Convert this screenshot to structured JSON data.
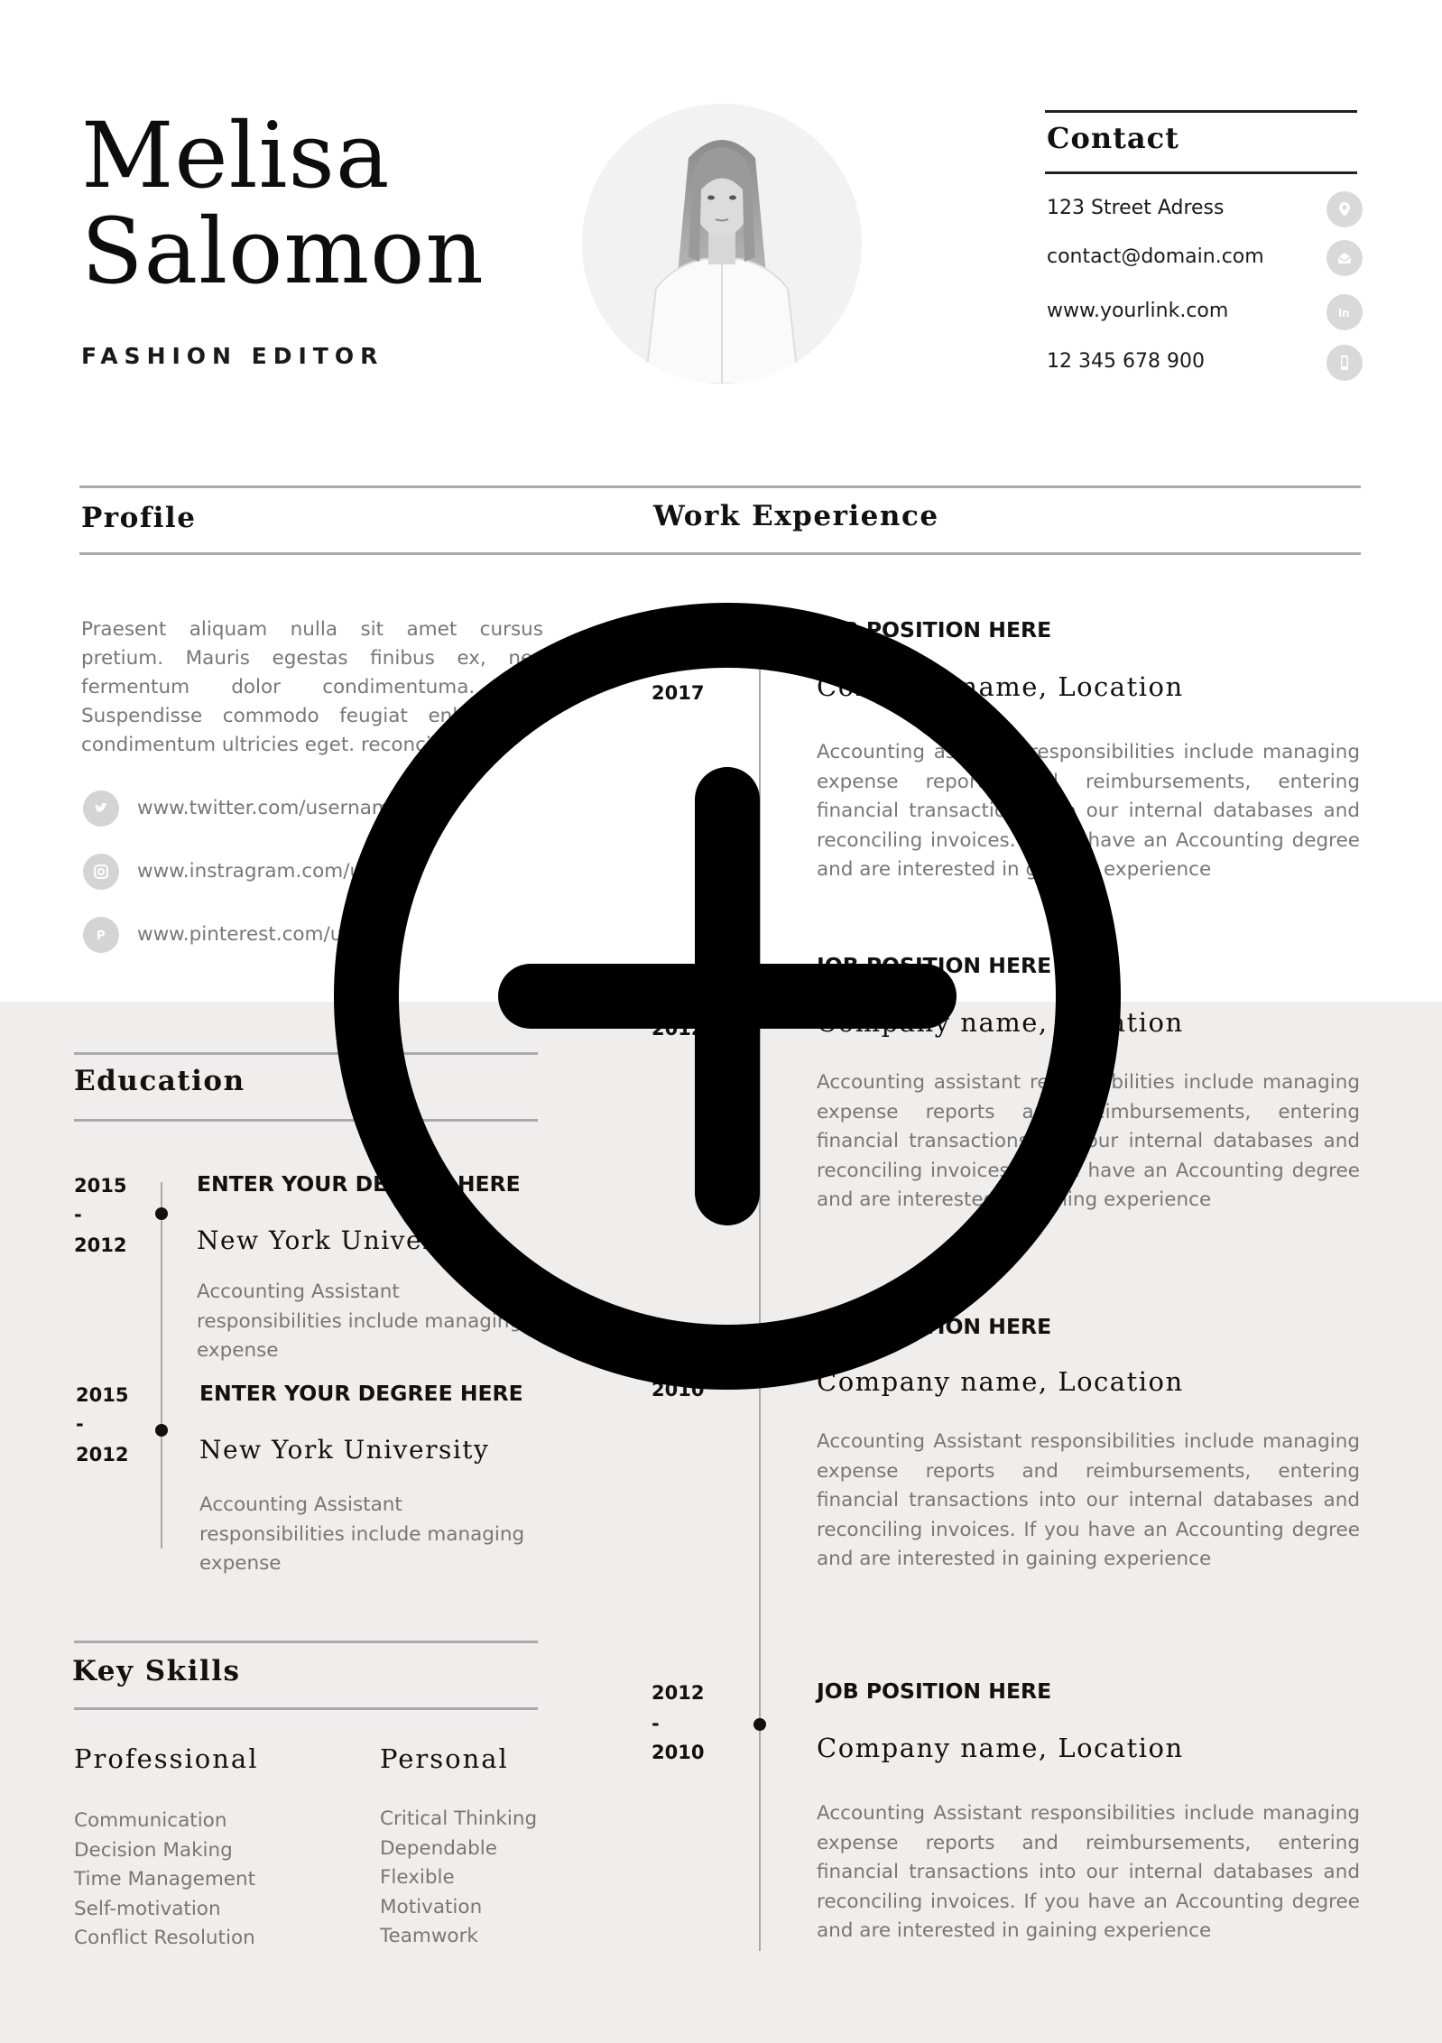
{
  "header": {
    "first_name": "Melisa",
    "last_name": "Salomon",
    "role": "FASHION EDITOR"
  },
  "contact": {
    "title": "Contact",
    "items": [
      {
        "text": "123 Street Adress",
        "icon": "location-pin-icon"
      },
      {
        "text": "contact@domain.com",
        "icon": "email-icon"
      },
      {
        "text": "www.yourlink.com",
        "icon": "linkedin-icon"
      },
      {
        "text": "12 345 678 900",
        "icon": "phone-icon"
      }
    ]
  },
  "profile": {
    "title": "Profile",
    "text": "Praesent aliquam nulla sit amet cursus pretium. Mauris egestas finibus ex, nec fermentum dolor condimentuma. At. Suspendisse commodo feugiat enla si le condimentum ultricies eget. reconcili the",
    "social": [
      {
        "text": "www.twitter.com/usernam",
        "icon": "twitter-icon"
      },
      {
        "text": "www.instragram.com/u",
        "icon": "instagram-icon"
      },
      {
        "text": "www.pinterest.com/us",
        "icon": "pinterest-icon"
      }
    ]
  },
  "work": {
    "title": "Work Experience",
    "jobs": [
      {
        "years": [
          "2017"
        ],
        "position": "JOB POSITION HERE",
        "company": "Company name, Location",
        "description": "Accounting assistant responsibilities include managing expense reports and reimbursements, entering financial transactions into our internal databases and reconciling invoices. If you have an Accounting degree and are interested in gaining experience"
      },
      {
        "years": [
          "2012"
        ],
        "position": "JOB POSITION HERE",
        "company": "Company name, Location",
        "description": "Accounting assistant responsibilities include managing expense reports and reimbursements, entering financial transactions into our internal databases and reconciling invoices. If you have an Accounting degree and are interested in gaining experience"
      },
      {
        "years": [
          "2010"
        ],
        "position": "JOB POSITION HERE",
        "company": "Company name, Location",
        "description": "Accounting Assistant responsibilities include managing expense reports and reimbursements, entering financial transactions into our internal databases and reconciling invoices. If you have an Accounting degree and are interested in gaining experience"
      },
      {
        "years": [
          "2012",
          "-",
          "2010"
        ],
        "position": "JOB POSITION HERE",
        "company": "Company name, Location",
        "description": "Accounting Assistant responsibilities include managing expense reports and reimbursements, entering financial transactions into our internal databases and reconciling invoices. If you have an Accounting degree and are interested in gaining experience"
      }
    ]
  },
  "education": {
    "title": "Education",
    "items": [
      {
        "start": "2015",
        "dash": "-",
        "end": "2012",
        "degree": "ENTER YOUR DEGREE HERE",
        "school": "New York University",
        "description": "Accounting Assistant responsibilities include managing expense"
      },
      {
        "start": "2015",
        "dash": "-",
        "end": "2012",
        "degree": "ENTER YOUR DEGREE HERE",
        "school": "New York University",
        "description": "Accounting Assistant responsibilities include managing expense"
      }
    ]
  },
  "skills": {
    "title": "Key Skills",
    "professional": {
      "title": "Professional",
      "items": [
        "Communication",
        "Decision Making",
        "Time Management",
        "Self-motivation",
        "Conflict Resolution"
      ]
    },
    "personal": {
      "title": "Personal",
      "items": [
        "Critical Thinking",
        "Dependable",
        "Flexible",
        "Motivation",
        "Teamwork"
      ]
    }
  },
  "overlay": {
    "icon": "zoom-in-plus-icon"
  },
  "colors": {
    "band": "#efeeec",
    "line": "#a9a9b1",
    "text_muted": "#777777"
  }
}
